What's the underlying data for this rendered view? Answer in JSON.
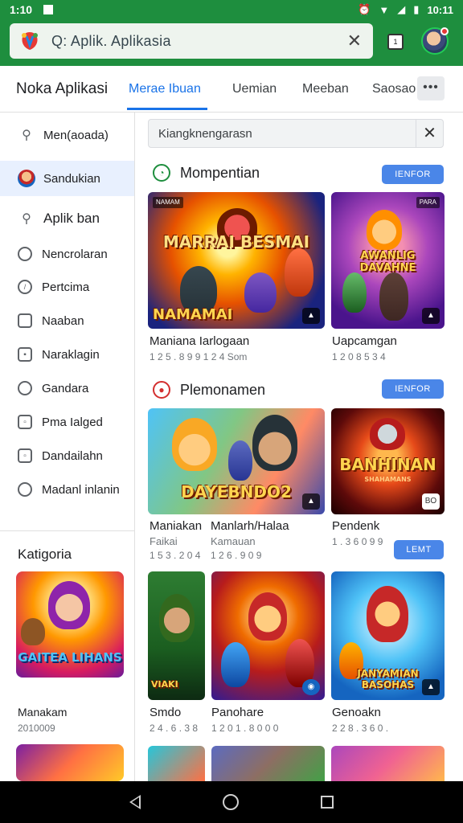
{
  "status_bar": {
    "time": "1:10",
    "clock": "10:11",
    "icons": [
      "alarm-icon",
      "wifi-icon",
      "signal-icon",
      "battery-icon"
    ]
  },
  "browser": {
    "url_text": "Q: Aplik. Aplikasia",
    "close": "✕",
    "tab_count": "1"
  },
  "app_nav": {
    "brand": "Noka Aplikasi",
    "tabs": [
      "Merae Ibuan",
      "Uemian",
      "Meeban",
      "Saosao"
    ],
    "active_tab": 0,
    "more": "•••"
  },
  "sidebar": {
    "items": [
      {
        "label": "Men(aoada)",
        "icon": "search-icon"
      },
      {
        "label": "Sandukian",
        "icon": "avatar-icon"
      },
      {
        "label": "Aplik ban",
        "icon": "search-icon"
      },
      {
        "label": "Nencrolaran",
        "icon": "square-icon"
      },
      {
        "label": "Pertcima",
        "icon": "compass-icon"
      },
      {
        "label": "Naaban",
        "icon": "square-icon"
      },
      {
        "label": "Naraklagin",
        "icon": "square-icon"
      },
      {
        "label": "Gandara",
        "icon": "compass-icon"
      },
      {
        "label": "Pma Ialged",
        "icon": "square-icon"
      },
      {
        "label": "Dandailahn",
        "icon": "square-icon"
      },
      {
        "label": "Madanl inlanin",
        "icon": "square-icon"
      }
    ],
    "category_title": "Katigoria",
    "category_card": {
      "name": "Manakam",
      "sub": "2010009",
      "art_title": "GAITEA LIHANS"
    }
  },
  "search": {
    "value": "Kiangknengarasn",
    "clear": "✕"
  },
  "sections": [
    {
      "title": "Mompentian",
      "button": "IENFOR",
      "cards": [
        {
          "name": "Maniana Iarlogaan",
          "sub": "1 2 5 . 8 9 9   1 2 4 Som",
          "art_title": "MARRAI BESMAI",
          "art_sub": "NAMAMAI",
          "tag": "NAMAM",
          "tagr": "",
          "badge": "▲"
        },
        {
          "name": "Uapcamgan",
          "sub": "1 2 0 8 5 3 4",
          "art_title": "AWANLIG DAVAHNE",
          "art_sub": "",
          "tag": "",
          "tagr": "PARA",
          "badge": "▲"
        }
      ]
    },
    {
      "title": "Plemonamen",
      "button": "IENFOR",
      "cards": [
        {
          "name": "Maniakan",
          "name2": "Manlarh/Halaa",
          "sub": "Faikai",
          "sub2": "Kamauan",
          "num": "1 5 3 . 2 0 4",
          "num2": "1 2 6 . 9 0 9",
          "art_title": "DAYEBNDO2",
          "badge": "▲"
        },
        {
          "name": "Pendenk",
          "sub": "1 . 3 6 0 9 9",
          "art_title": "BANHINAN",
          "art_sub": "SHAHAMANS",
          "badge": "BO"
        }
      ],
      "more_button": "LEMT"
    }
  ],
  "grid_row": [
    {
      "name": "Smdo",
      "sub": "2 4 . 6 . 3 8",
      "art_title": "VIAKI"
    },
    {
      "name": "Panohare",
      "sub": "1 2 0 1 . 8 0 0 0",
      "art_title": ""
    },
    {
      "name": "Genoakn",
      "sub": "2 2 8 . 3 6 0 .",
      "art_title": "JANYAMIAN BASOHAS"
    }
  ],
  "system_nav": [
    "back-icon",
    "home-icon",
    "recents-icon"
  ]
}
